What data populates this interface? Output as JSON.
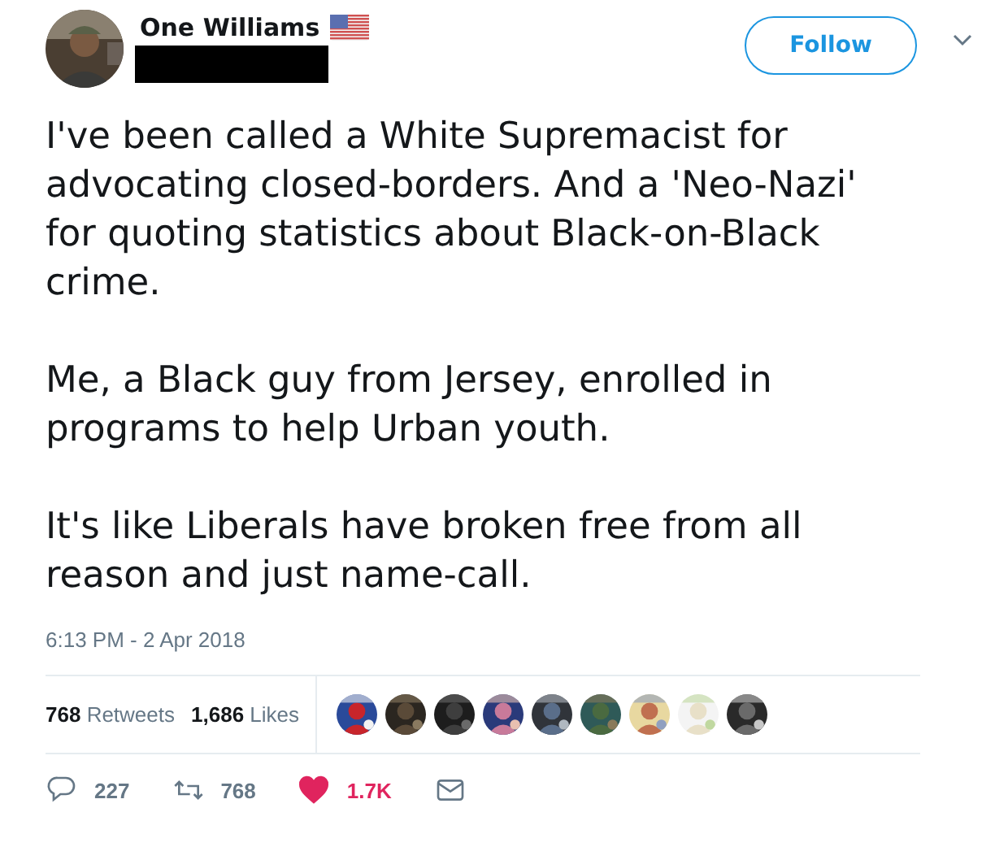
{
  "author": {
    "name": "One Williams",
    "handle_redacted": true,
    "verified_flag": true
  },
  "follow_button": {
    "label": "Follow"
  },
  "tweet": {
    "paragraphs": [
      "I've been called a White Supremacist for advocating closed-borders. And a 'Neo-Nazi' for quoting statistics about Black-on-Black crime.",
      "Me, a Black guy from Jersey, enrolled in programs to help Urban youth.",
      "It's like Liberals have broken free from all reason and just name-call."
    ],
    "timestamp": "6:13 PM - 2 Apr 2018"
  },
  "stats": [
    {
      "count": "768",
      "label": "Retweets"
    },
    {
      "count": "1,686",
      "label": "Likes"
    }
  ],
  "actions": [
    {
      "kind": "reply",
      "count": "227",
      "selected": false
    },
    {
      "kind": "retweet",
      "count": "768",
      "selected": false
    },
    {
      "kind": "like",
      "count": "1.7K",
      "selected": true
    },
    {
      "kind": "message",
      "selected": false
    }
  ]
}
